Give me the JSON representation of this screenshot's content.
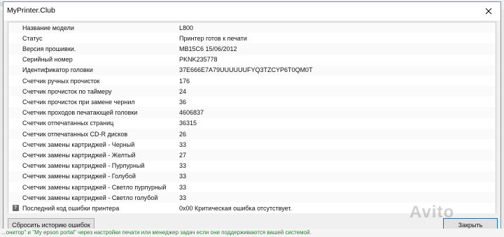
{
  "window": {
    "title": "MyPrinter.Club"
  },
  "rows": [
    {
      "label": "Название модели",
      "value": "L800"
    },
    {
      "label": "Статус",
      "value": "Принтер готов к печати"
    },
    {
      "label": "Версия прошивки.",
      "value": "MB15C6 15/06/2012"
    },
    {
      "label": "Серийный номер",
      "value": "PKNK235778"
    },
    {
      "label": "Идентификатор головки",
      "value": "37E666E7A79UUUUUUFYQ3TZCYP6T0QM0T"
    },
    {
      "label": "Счетчик ручных прочисток",
      "value": "176"
    },
    {
      "label": "Счетчик прочисток по таймеру",
      "value": "24"
    },
    {
      "label": "Счетчик прочисток при замене чернил",
      "value": "36"
    },
    {
      "label": "Счетчик проходов печатающей головки",
      "value": "4606837"
    },
    {
      "label": "Счетчик отпечатанных страниц",
      "value": "36315"
    },
    {
      "label": "Счетчик отпечатанных CD-R дисков",
      "value": "26"
    },
    {
      "label": "Счетчик замены картриджей - Черный",
      "value": "33"
    },
    {
      "label": "Счетчик замены картриджей - Желтый",
      "value": "27"
    },
    {
      "label": "Счетчик замены картриджей - Пурпурный",
      "value": "33"
    },
    {
      "label": "Счетчик замены картриджей - Голубой",
      "value": "33"
    },
    {
      "label": "Счетчик замены картриджей - Светло пурпурный",
      "value": "33"
    },
    {
      "label": "Счетчик замены картриджей - Светло голубой",
      "value": "33"
    },
    {
      "label": "Последний код ошибки принтера",
      "value": "0x00 Критическая ошибка отсутствует."
    }
  ],
  "buttons": {
    "reset_errors": "Сбросить историю ошибок",
    "close": "Закрыть"
  },
  "background": {
    "bottom_text": "...онитор\" и \"My epson portal\" через настройки печати или менеджер задач если они поддерживаются вашей системой."
  },
  "watermark": {
    "text": "Avito"
  },
  "icons": {
    "row_help": "question-icon",
    "close": "close-icon"
  }
}
